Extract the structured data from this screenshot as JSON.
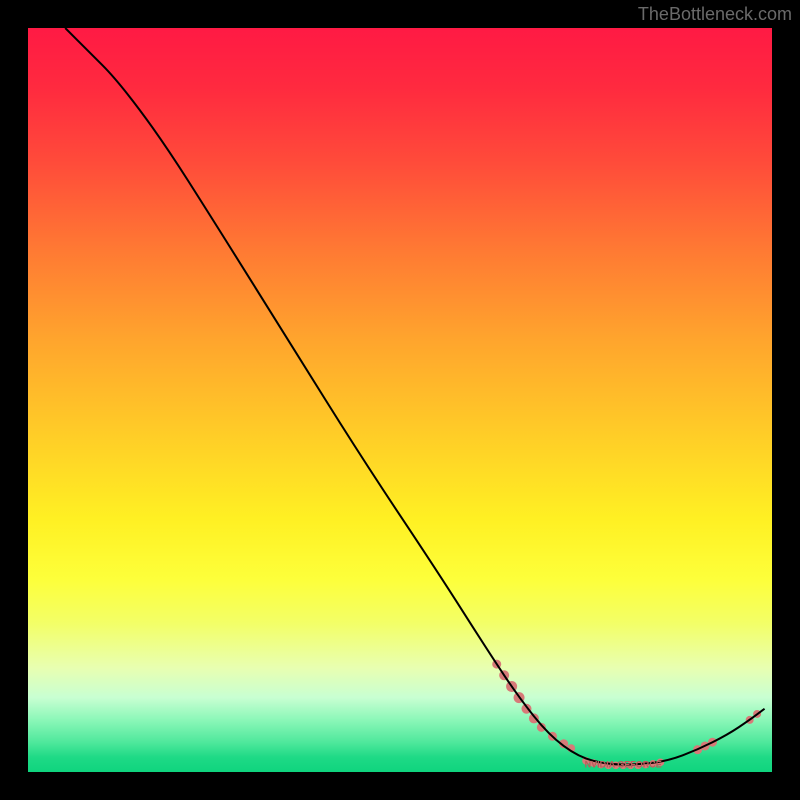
{
  "watermark": "TheBottleneck.com",
  "chart_data": {
    "type": "line",
    "title": "",
    "xlabel": "",
    "ylabel": "",
    "xlim": [
      0,
      100
    ],
    "ylim": [
      0,
      100
    ],
    "curve": [
      {
        "x": 5,
        "y": 100
      },
      {
        "x": 8,
        "y": 97
      },
      {
        "x": 12,
        "y": 93
      },
      {
        "x": 18,
        "y": 85
      },
      {
        "x": 25,
        "y": 74
      },
      {
        "x": 35,
        "y": 58
      },
      {
        "x": 45,
        "y": 42
      },
      {
        "x": 55,
        "y": 27
      },
      {
        "x": 62,
        "y": 16
      },
      {
        "x": 66,
        "y": 10
      },
      {
        "x": 70,
        "y": 5
      },
      {
        "x": 74,
        "y": 2
      },
      {
        "x": 78,
        "y": 1
      },
      {
        "x": 82,
        "y": 1
      },
      {
        "x": 86,
        "y": 1.5
      },
      {
        "x": 90,
        "y": 3
      },
      {
        "x": 94,
        "y": 5
      },
      {
        "x": 97,
        "y": 7
      },
      {
        "x": 99,
        "y": 8.5
      }
    ],
    "dot_clusters": [
      {
        "x": 63,
        "y": 14.5,
        "r": 4.5
      },
      {
        "x": 64,
        "y": 13,
        "r": 5
      },
      {
        "x": 65,
        "y": 11.5,
        "r": 5.5
      },
      {
        "x": 66,
        "y": 10,
        "r": 5.5
      },
      {
        "x": 67,
        "y": 8.5,
        "r": 5
      },
      {
        "x": 68,
        "y": 7.2,
        "r": 5
      },
      {
        "x": 69,
        "y": 6,
        "r": 4.5
      },
      {
        "x": 70.5,
        "y": 4.8,
        "r": 4.5
      },
      {
        "x": 72,
        "y": 3.8,
        "r": 4.5
      },
      {
        "x": 73,
        "y": 3.2,
        "r": 4
      },
      {
        "x": 75,
        "y": 1.5,
        "r": 3.8
      },
      {
        "x": 76,
        "y": 1.2,
        "r": 3.8
      },
      {
        "x": 77,
        "y": 1.0,
        "r": 3.8
      },
      {
        "x": 78,
        "y": 0.9,
        "r": 3.8
      },
      {
        "x": 79,
        "y": 0.9,
        "r": 3.8
      },
      {
        "x": 80,
        "y": 0.9,
        "r": 3.8
      },
      {
        "x": 81,
        "y": 0.9,
        "r": 3.8
      },
      {
        "x": 82,
        "y": 0.9,
        "r": 3.8
      },
      {
        "x": 83,
        "y": 1.0,
        "r": 3.8
      },
      {
        "x": 84,
        "y": 1.1,
        "r": 3.8
      },
      {
        "x": 85,
        "y": 1.3,
        "r": 3.8
      },
      {
        "x": 90,
        "y": 3.0,
        "r": 4.5
      },
      {
        "x": 91,
        "y": 3.5,
        "r": 4.5
      },
      {
        "x": 92,
        "y": 4.0,
        "r": 4.5
      },
      {
        "x": 97,
        "y": 7.0,
        "r": 4
      },
      {
        "x": 98,
        "y": 7.8,
        "r": 4
      }
    ],
    "dot_cluster_label": {
      "text": "NVIDIA GEFORCE",
      "x": 80,
      "y": 1.0
    },
    "dot_color": "#d77a78",
    "curve_color": "#000000"
  }
}
